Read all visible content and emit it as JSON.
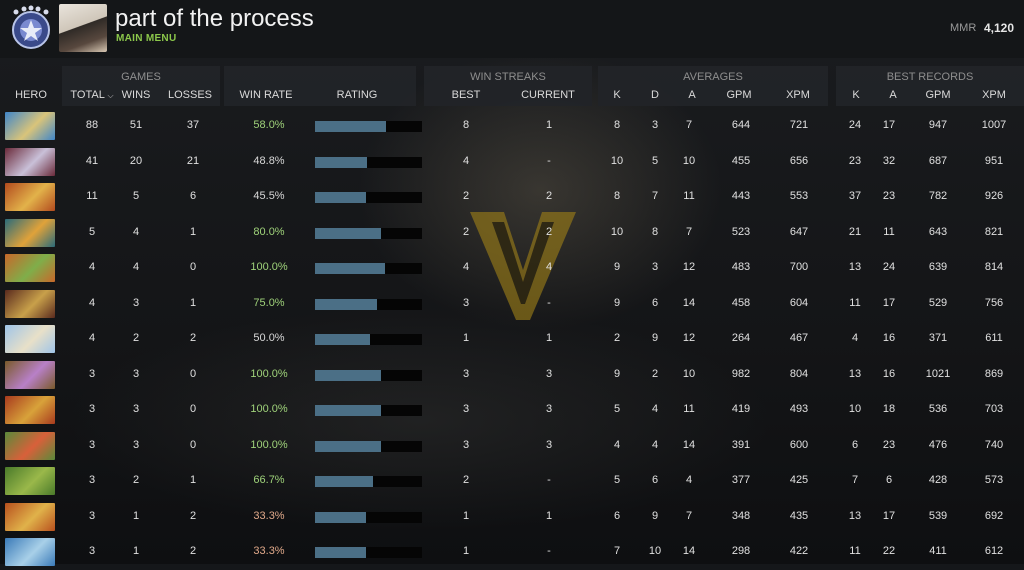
{
  "header": {
    "title": "part of the process",
    "subtitle": "MAIN MENU",
    "mmr_label": "MMR",
    "mmr_value": "4,120"
  },
  "groups": {
    "games": "GAMES",
    "win_streaks": "WIN STREAKS",
    "averages": "AVERAGES",
    "best_records": "BEST RECORDS"
  },
  "columns": {
    "hero": "HERO",
    "total": "TOTAL",
    "wins": "WINS",
    "losses": "LOSSES",
    "win_rate": "WIN RATE",
    "rating": "RATING",
    "best": "BEST",
    "current": "CURRENT",
    "avg_k": "K",
    "avg_d": "D",
    "avg_a": "A",
    "avg_gpm": "GPM",
    "avg_xpm": "XPM",
    "best_k": "K",
    "best_a": "A",
    "best_gpm": "GPM",
    "best_xpm": "XPM"
  },
  "colors": {
    "win_rate_good": "#9fd27a",
    "win_rate_neutral": "#d8d8d8",
    "win_rate_bad": "#e0a98a",
    "rating_fill": "#4b6f86",
    "accent_green": "#8cc84b"
  },
  "rows": [
    {
      "hero_icon": "hero-portrait-icon",
      "total": "88",
      "wins": "51",
      "losses": "37",
      "win_rate": "58.0%",
      "rating": 0.66,
      "best": "8",
      "current": "1",
      "k": "8",
      "d": "3",
      "a": "7",
      "gpm": "644",
      "xpm": "721",
      "bk": "24",
      "ba": "17",
      "bgpm": "947",
      "bxpm": "1007",
      "tone": "good",
      "c1": "#3f86c9",
      "c2": "#d9c47a"
    },
    {
      "hero_icon": "hero-portrait-icon",
      "total": "41",
      "wins": "20",
      "losses": "21",
      "win_rate": "48.8%",
      "rating": 0.49,
      "best": "4",
      "current": "-",
      "k": "10",
      "d": "5",
      "a": "10",
      "gpm": "455",
      "xpm": "656",
      "bk": "23",
      "ba": "32",
      "bgpm": "687",
      "bxpm": "951",
      "tone": "neutral",
      "c1": "#6a2a3a",
      "c2": "#c9c0d8"
    },
    {
      "hero_icon": "hero-portrait-icon",
      "total": "11",
      "wins": "5",
      "losses": "6",
      "win_rate": "45.5%",
      "rating": 0.48,
      "best": "2",
      "current": "2",
      "k": "8",
      "d": "7",
      "a": "11",
      "gpm": "443",
      "xpm": "553",
      "bk": "37",
      "ba": "23",
      "bgpm": "782",
      "bxpm": "926",
      "tone": "neutral",
      "c1": "#b24a1e",
      "c2": "#e2b24a"
    },
    {
      "hero_icon": "hero-portrait-icon",
      "total": "5",
      "wins": "4",
      "losses": "1",
      "win_rate": "80.0%",
      "rating": 0.62,
      "best": "2",
      "current": "2",
      "k": "10",
      "d": "8",
      "a": "7",
      "gpm": "523",
      "xpm": "647",
      "bk": "21",
      "ba": "11",
      "bgpm": "643",
      "bxpm": "821",
      "tone": "good",
      "c1": "#2a6b7a",
      "c2": "#e0a23a"
    },
    {
      "hero_icon": "hero-portrait-icon",
      "total": "4",
      "wins": "4",
      "losses": "0",
      "win_rate": "100.0%",
      "rating": 0.65,
      "best": "4",
      "current": "4",
      "k": "9",
      "d": "3",
      "a": "12",
      "gpm": "483",
      "xpm": "700",
      "bk": "13",
      "ba": "24",
      "bgpm": "639",
      "bxpm": "814",
      "tone": "good",
      "c1": "#c8682a",
      "c2": "#7fae4a"
    },
    {
      "hero_icon": "hero-portrait-icon",
      "total": "4",
      "wins": "3",
      "losses": "1",
      "win_rate": "75.0%",
      "rating": 0.58,
      "best": "3",
      "current": "-",
      "k": "9",
      "d": "6",
      "a": "14",
      "gpm": "458",
      "xpm": "604",
      "bk": "11",
      "ba": "17",
      "bgpm": "529",
      "bxpm": "756",
      "tone": "good",
      "c1": "#5a2a1e",
      "c2": "#c8a04a"
    },
    {
      "hero_icon": "hero-portrait-icon",
      "total": "4",
      "wins": "2",
      "losses": "2",
      "win_rate": "50.0%",
      "rating": 0.51,
      "best": "1",
      "current": "1",
      "k": "2",
      "d": "9",
      "a": "12",
      "gpm": "264",
      "xpm": "467",
      "bk": "4",
      "ba": "16",
      "bgpm": "371",
      "bxpm": "611",
      "tone": "neutral",
      "c1": "#9fc4e8",
      "c2": "#e8e0c8"
    },
    {
      "hero_icon": "hero-portrait-icon",
      "total": "3",
      "wins": "3",
      "losses": "0",
      "win_rate": "100.0%",
      "rating": 0.62,
      "best": "3",
      "current": "3",
      "k": "9",
      "d": "2",
      "a": "10",
      "gpm": "982",
      "xpm": "804",
      "bk": "13",
      "ba": "16",
      "bgpm": "1021",
      "bxpm": "869",
      "tone": "good",
      "c1": "#7a5a2a",
      "c2": "#b880c8"
    },
    {
      "hero_icon": "hero-portrait-icon",
      "total": "3",
      "wins": "3",
      "losses": "0",
      "win_rate": "100.0%",
      "rating": 0.62,
      "best": "3",
      "current": "3",
      "k": "5",
      "d": "4",
      "a": "11",
      "gpm": "419",
      "xpm": "493",
      "bk": "10",
      "ba": "18",
      "bgpm": "536",
      "bxpm": "703",
      "tone": "good",
      "c1": "#a83a1e",
      "c2": "#d8a23a"
    },
    {
      "hero_icon": "hero-portrait-icon",
      "total": "3",
      "wins": "3",
      "losses": "0",
      "win_rate": "100.0%",
      "rating": 0.62,
      "best": "3",
      "current": "3",
      "k": "4",
      "d": "4",
      "a": "14",
      "gpm": "391",
      "xpm": "600",
      "bk": "6",
      "ba": "23",
      "bgpm": "476",
      "bxpm": "740",
      "tone": "good",
      "c1": "#5a8a3a",
      "c2": "#d8603a"
    },
    {
      "hero_icon": "hero-portrait-icon",
      "total": "3",
      "wins": "2",
      "losses": "1",
      "win_rate": "66.7%",
      "rating": 0.54,
      "best": "2",
      "current": "-",
      "k": "5",
      "d": "6",
      "a": "4",
      "gpm": "377",
      "xpm": "425",
      "bk": "7",
      "ba": "6",
      "bgpm": "428",
      "bxpm": "573",
      "tone": "good",
      "c1": "#4a7a2a",
      "c2": "#9ab84a"
    },
    {
      "hero_icon": "hero-portrait-icon",
      "total": "3",
      "wins": "1",
      "losses": "2",
      "win_rate": "33.3%",
      "rating": 0.48,
      "best": "1",
      "current": "1",
      "k": "6",
      "d": "9",
      "a": "7",
      "gpm": "348",
      "xpm": "435",
      "bk": "13",
      "ba": "17",
      "bgpm": "539",
      "bxpm": "692",
      "tone": "bad",
      "c1": "#b8501e",
      "c2": "#e0b24a"
    },
    {
      "hero_icon": "hero-portrait-icon",
      "total": "3",
      "wins": "1",
      "losses": "2",
      "win_rate": "33.3%",
      "rating": 0.48,
      "best": "1",
      "current": "-",
      "k": "7",
      "d": "10",
      "a": "14",
      "gpm": "298",
      "xpm": "422",
      "bk": "11",
      "ba": "22",
      "bgpm": "411",
      "bxpm": "612",
      "tone": "bad",
      "c1": "#3a7ab8",
      "c2": "#a8d0e8"
    }
  ]
}
